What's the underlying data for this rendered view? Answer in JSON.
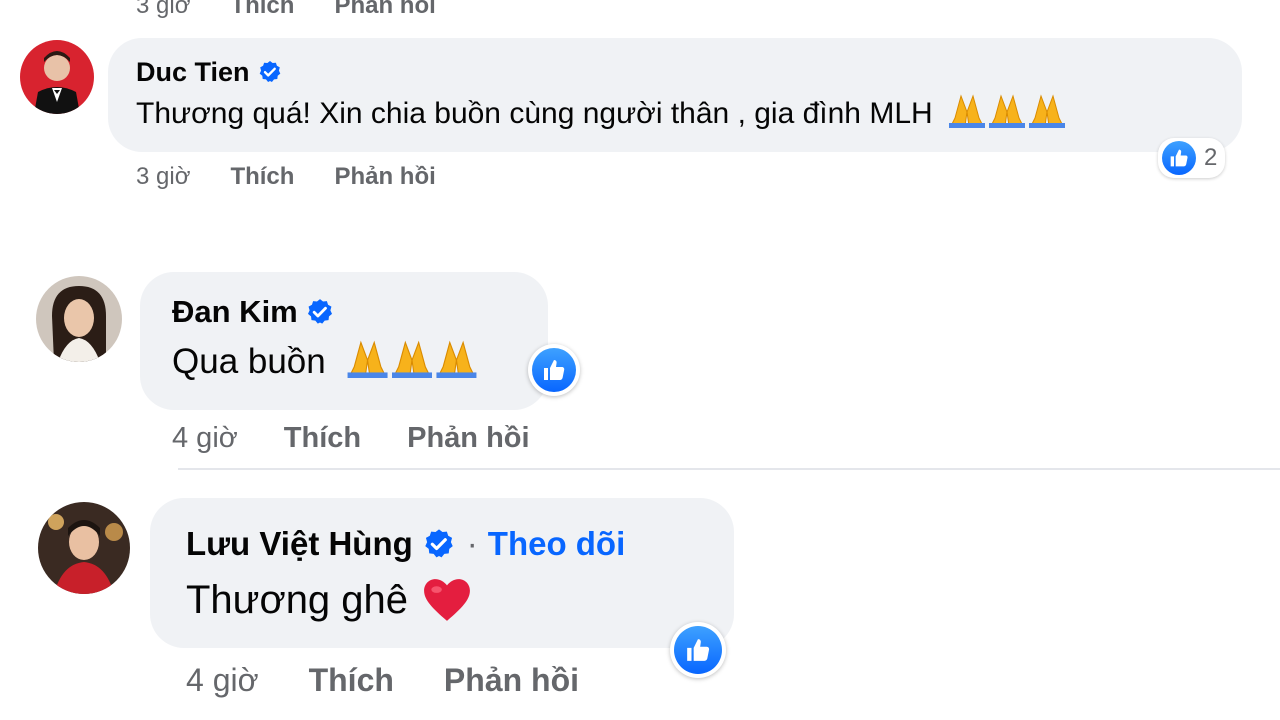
{
  "colors": {
    "bubble": "#f0f2f5",
    "link": "#0866ff",
    "meta": "#65676b",
    "like": "#0866ff",
    "heart": "#e41e3f"
  },
  "top_meta": {
    "time": "3 giờ",
    "like": "Thích",
    "reply": "Phản hồi"
  },
  "comments": [
    {
      "author": "Duc Tien",
      "verified": true,
      "text": "Thương quá! Xin chia buồn cùng người thân , gia đình MLH",
      "emoji": "pray-emoji x3",
      "reaction_count": "2",
      "time": "3 giờ",
      "like": "Thích",
      "reply": "Phản hồi"
    },
    {
      "author": "Đan Kim",
      "verified": true,
      "text": "Qua buồn",
      "emoji": "pray-emoji x3",
      "time": "4 giờ",
      "like": "Thích",
      "reply": "Phản hồi"
    },
    {
      "author": "Lưu Việt Hùng",
      "verified": true,
      "follow_separator": "·",
      "follow": "Theo dõi",
      "text": "Thương ghê",
      "emoji": "heart-emoji",
      "time": "4 giờ",
      "like": "Thích",
      "reply": "Phản hồi"
    }
  ]
}
